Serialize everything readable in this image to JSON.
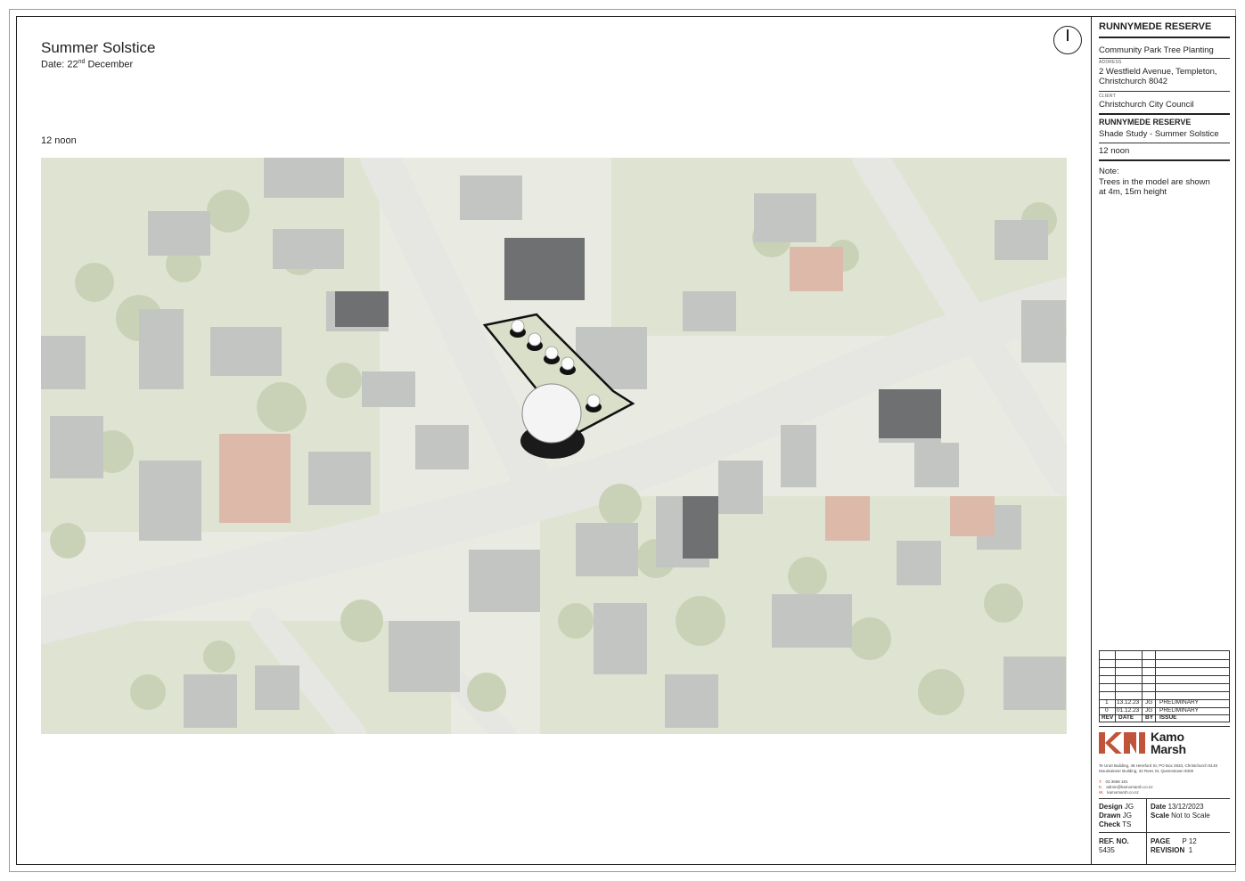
{
  "sheet": {
    "title": "Summer Solstice",
    "date_prefix": "Date: 22",
    "date_sup": "nd",
    "date_suffix": " December",
    "time_label": "12 noon"
  },
  "title_block": {
    "project": "RUNNYMEDE RESERVE",
    "project_desc": "Community Park Tree Planting",
    "address_caption": "ADDRESS",
    "address_line1": "2 Westfield Avenue, Templeton,",
    "address_line2": "Christchurch 8042",
    "client_caption": "CLIENT",
    "client": "Christchurch City Council",
    "drawing_title": "RUNNYMEDE RESERVE",
    "drawing_sub": "Shade Study - Summer Solstice",
    "drawing_time": "12 noon",
    "note_heading": "Note:",
    "note_line1": "Trees in the model are shown",
    "note_line2": "at 4m, 15m height"
  },
  "revisions": {
    "headers": [
      "REV",
      "DATE",
      "BY",
      "ISSUE"
    ],
    "rows": [
      {
        "rev": "1",
        "date": "13.12.23",
        "by": "JG",
        "issue": "PRELIMINARY"
      },
      {
        "rev": "0",
        "date": "01.12.23",
        "by": "JG",
        "issue": "PRELIMINARY"
      }
    ]
  },
  "company": {
    "name_line1": "Kamo",
    "name_line2": "Marsh",
    "brand_color": "#c0533a",
    "address1": "Te Urutī Building, 48 Hereford St, PO Box 2833, Christchurch 8140",
    "address2": "Mountaineer Building, 32 Rees St, Queenstown 9300",
    "phone_key": "T.",
    "phone": "03 3668 181",
    "email_key": "E.",
    "email": "admin@kamomarsh.co.nz",
    "web_key": "W.",
    "web": "kamomarsh.co.nz"
  },
  "meta": {
    "design_label": "Design",
    "design_value": "JG",
    "drawn_label": "Drawn",
    "drawn_value": "JG",
    "check_label": "Check",
    "check_value": "TS",
    "date_label": "Date",
    "date_value": "13/12/2023",
    "scale_label": "Scale",
    "scale_value": "Not to Scale",
    "ref_label": "REF. NO.",
    "ref_value": "5435",
    "page_label": "PAGE",
    "page_value": "P 12",
    "revision_label": "REVISION",
    "revision_value": "1"
  },
  "icons": {
    "north_arrow": "north-arrow-icon",
    "logo": "kamo-marsh-logo"
  }
}
